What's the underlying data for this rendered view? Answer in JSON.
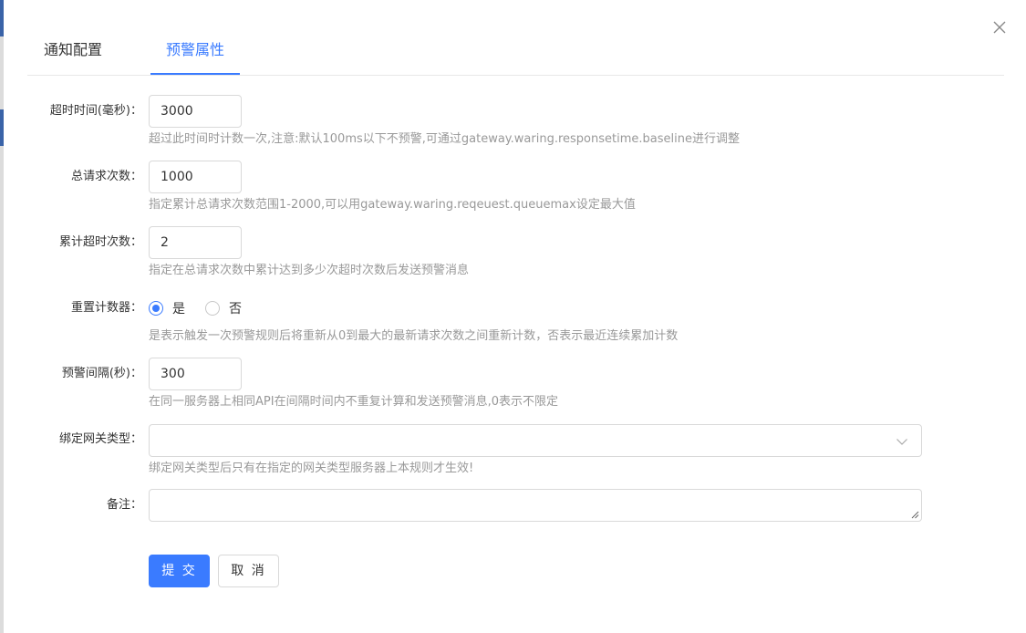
{
  "tabs": [
    {
      "label": "通知配置",
      "active": false
    },
    {
      "label": "预警属性",
      "active": true
    }
  ],
  "colors": {
    "accent": "#3a7bff",
    "border": "#d9d9d9",
    "hint": "#999999"
  },
  "icons": {
    "close": "close-icon",
    "select": "chevron-down-icon"
  },
  "form": {
    "timeout": {
      "label": "超时时间(毫秒)：",
      "value": "3000",
      "hint": "超过此时间时计数一次,注意:默认100ms以下不预警,可通过gateway.waring.responsetime.baseline进行调整"
    },
    "total_requests": {
      "label": "总请求次数：",
      "value": "1000",
      "hint": "指定累计总请求次数范围1-2000,可以用gateway.waring.reqeuest.queuemax设定最大值"
    },
    "cumulative_timeouts": {
      "label": "累计超时次数：",
      "value": "2",
      "hint": "指定在总请求次数中累计达到多少次超时次数后发送预警消息"
    },
    "reset_counter": {
      "label": "重置计数器：",
      "options": [
        {
          "label": "是",
          "selected": true
        },
        {
          "label": "否",
          "selected": false
        }
      ],
      "hint": "是表示触发一次预警规则后将重新从0到最大的最新请求次数之间重新计数，否表示最近连续累加计数"
    },
    "alert_interval": {
      "label": "预警间隔(秒)：",
      "value": "300",
      "hint": "在同一服务器上相同API在间隔时间内不重复计算和发送预警消息,0表示不限定"
    },
    "gateway_type": {
      "label": "绑定网关类型：",
      "value": "",
      "hint": "绑定网关类型后只有在指定的网关类型服务器上本规则才生效!"
    },
    "remark": {
      "label": "备注：",
      "value": ""
    }
  },
  "buttons": {
    "submit": "提 交",
    "cancel": "取 消"
  }
}
